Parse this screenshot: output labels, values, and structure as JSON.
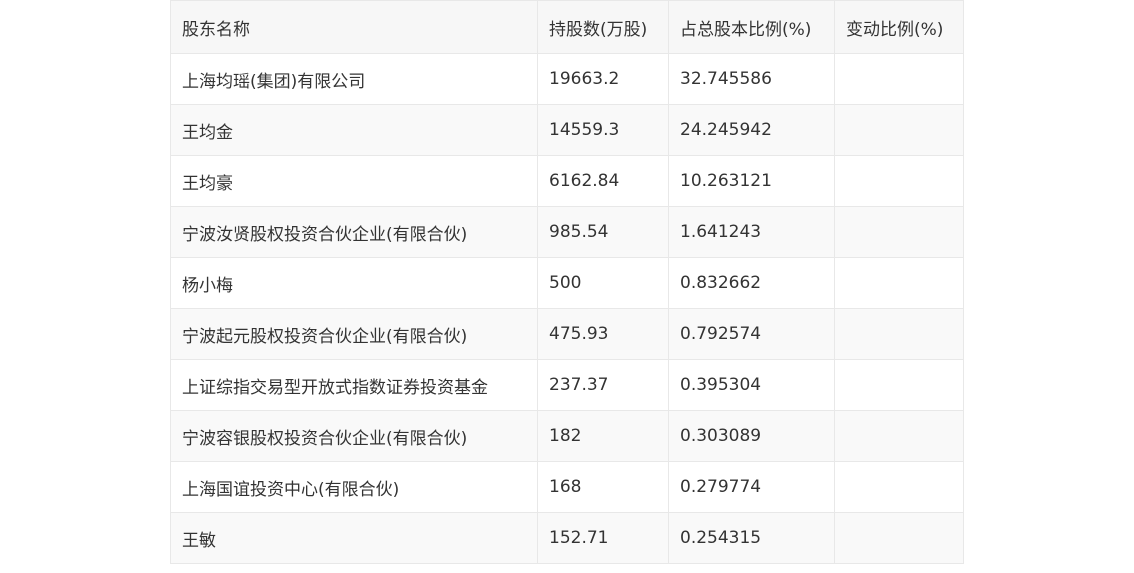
{
  "table": {
    "headers": [
      "股东名称",
      "持股数(万股)",
      "占总股本比例(%)",
      "变动比例(%)"
    ],
    "rows": [
      [
        "上海均瑶(集团)有限公司",
        "19663.2",
        "32.745586",
        ""
      ],
      [
        "王均金",
        "14559.3",
        "24.245942",
        ""
      ],
      [
        "王均豪",
        "6162.84",
        "10.263121",
        ""
      ],
      [
        "宁波汝贤股权投资合伙企业(有限合伙)",
        "985.54",
        "1.641243",
        ""
      ],
      [
        "杨小梅",
        "500",
        "0.832662",
        ""
      ],
      [
        "宁波起元股权投资合伙企业(有限合伙)",
        "475.93",
        "0.792574",
        ""
      ],
      [
        "上证综指交易型开放式指数证券投资基金",
        "237.37",
        "0.395304",
        ""
      ],
      [
        "宁波容银股权投资合伙企业(有限合伙)",
        "182",
        "0.303089",
        ""
      ],
      [
        "上海国谊投资中心(有限合伙)",
        "168",
        "0.279774",
        ""
      ],
      [
        "王敏",
        "152.71",
        "0.254315",
        ""
      ]
    ]
  }
}
